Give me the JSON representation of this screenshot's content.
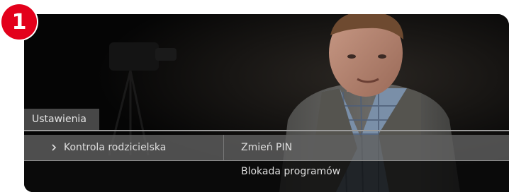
{
  "step_badge": {
    "number": "1",
    "color": "#e3001b"
  },
  "menu": {
    "title": "Ustawienia",
    "left_items": [
      {
        "label": "Kontrola rodzicielska",
        "icon": "chevron-right-icon",
        "selected": true
      }
    ],
    "right_items": [
      {
        "label": "Zmień PIN"
      },
      {
        "label": "Blokada programów"
      }
    ]
  }
}
